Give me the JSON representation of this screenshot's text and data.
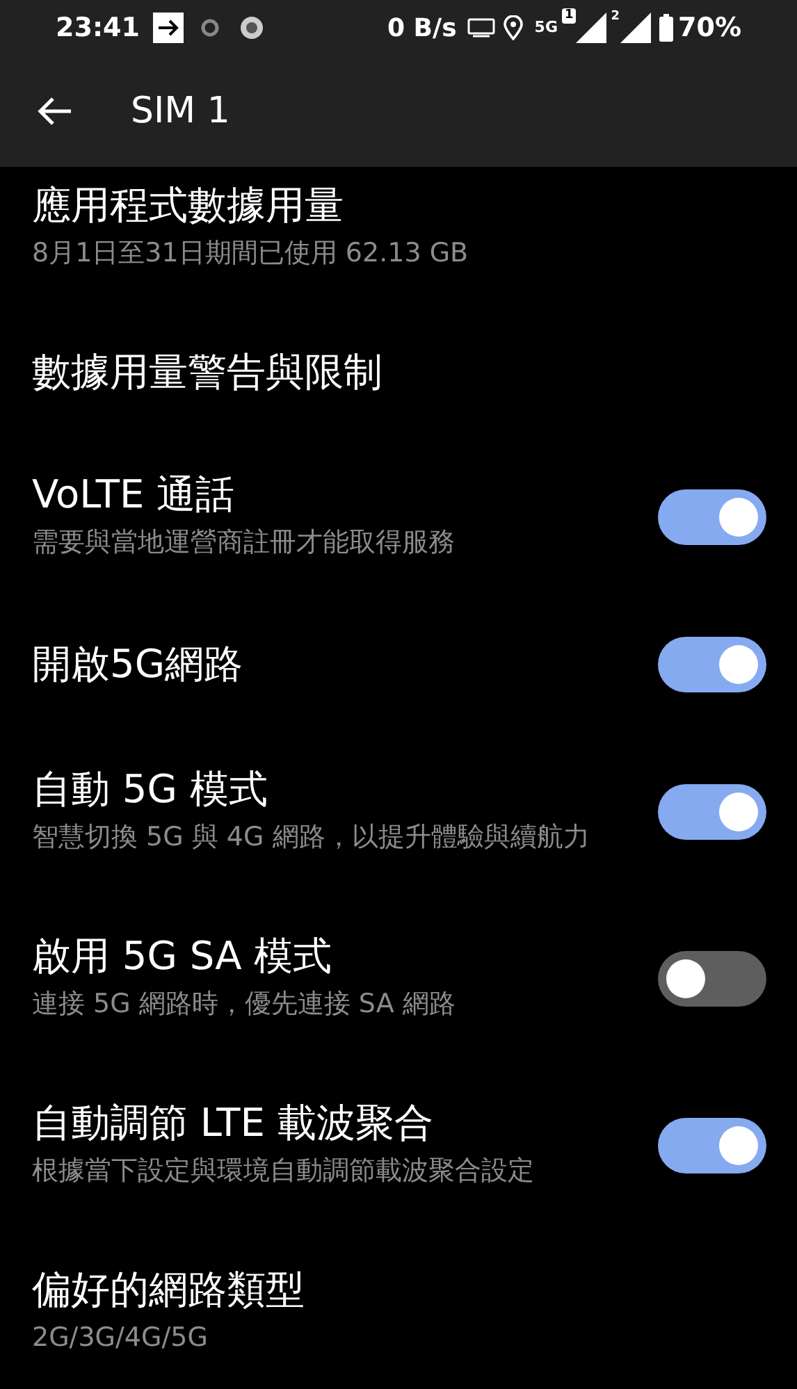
{
  "status_bar": {
    "time": "23:41",
    "data_speed": "0 B/s",
    "network_type": "5G",
    "sim_1_label": "1",
    "sim_2_label": "2",
    "battery": "70%"
  },
  "app_bar": {
    "title": "SIM 1"
  },
  "settings": [
    {
      "kind": "link",
      "title": "應用程式數據用量",
      "subtitle": "8月1日至31日期間已使用 62.13 GB"
    },
    {
      "kind": "link",
      "title": "數據用量警告與限制"
    },
    {
      "kind": "toggle",
      "title": "VoLTE 通話",
      "subtitle": "需要與當地運營商註冊才能取得服務",
      "on": true
    },
    {
      "kind": "toggle",
      "title": "開啟5G網路",
      "on": true
    },
    {
      "kind": "toggle",
      "title": "自動 5G 模式",
      "subtitle": "智慧切換 5G 與 4G 網路，以提升體驗與續航力",
      "on": true
    },
    {
      "kind": "toggle",
      "title": "啟用 5G SA 模式",
      "subtitle": "連接 5G 網路時，優先連接 SA 網路",
      "on": false
    },
    {
      "kind": "toggle",
      "title": "自動調節 LTE 載波聚合",
      "subtitle": "根據當下設定與環境自動調節載波聚合設定",
      "on": true
    },
    {
      "kind": "link",
      "title": "偏好的網路類型",
      "subtitle": "2G/3G/4G/5G"
    }
  ]
}
